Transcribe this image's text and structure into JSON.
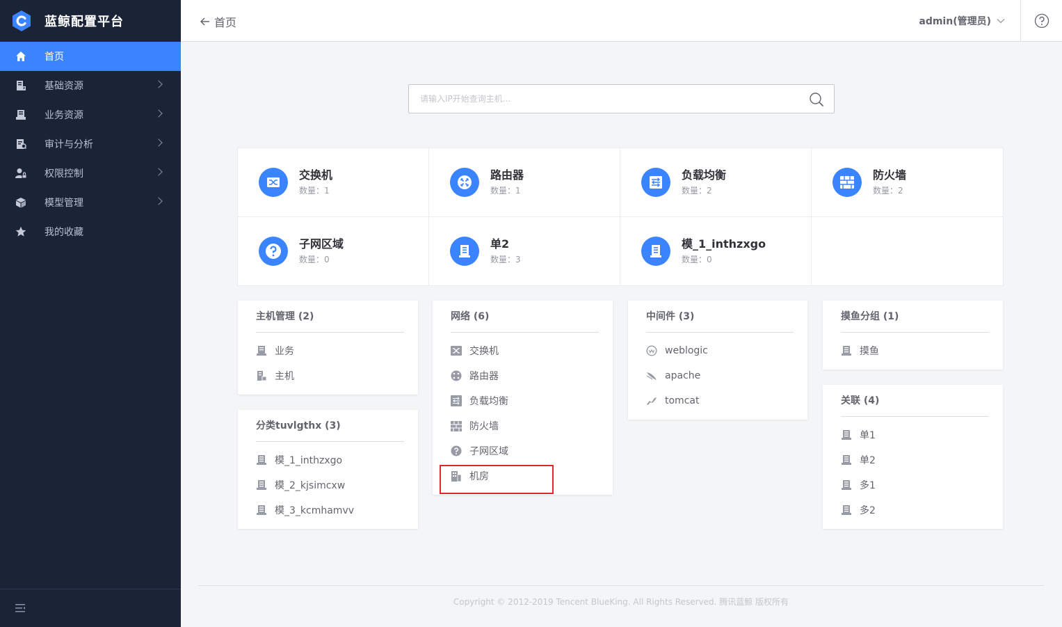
{
  "brand": {
    "title": "蓝鲸配置平台"
  },
  "sidebar": {
    "items": [
      {
        "label": "首页",
        "icon": "home-icon",
        "active": true,
        "arrow": false
      },
      {
        "label": "基础资源",
        "icon": "basic-resource-icon",
        "arrow": true
      },
      {
        "label": "业务资源",
        "icon": "business-resource-icon",
        "arrow": true
      },
      {
        "label": "审计与分析",
        "icon": "audit-icon",
        "arrow": true
      },
      {
        "label": "权限控制",
        "icon": "permission-icon",
        "arrow": true
      },
      {
        "label": "模型管理",
        "icon": "model-cube-icon",
        "arrow": true
      },
      {
        "label": "我的收藏",
        "icon": "star-icon",
        "arrow": false
      }
    ]
  },
  "header": {
    "back_label": "首页",
    "user_label": "admin(管理员)"
  },
  "search": {
    "placeholder": "请输入IP开始查询主机..."
  },
  "resources": {
    "count_prefix": "数量：",
    "items": [
      {
        "name": "交换机",
        "count": "1",
        "icon": "switch-icon"
      },
      {
        "name": "路由器",
        "count": "1",
        "icon": "router-icon"
      },
      {
        "name": "负载均衡",
        "count": "2",
        "icon": "load-balance-icon"
      },
      {
        "name": "防火墙",
        "count": "2",
        "icon": "firewall-icon"
      },
      {
        "name": "子网区域",
        "count": "0",
        "icon": "question-icon"
      },
      {
        "name": "单2",
        "count": "3",
        "icon": "model-icon"
      },
      {
        "name": "模_1_inthzxgo",
        "count": "0",
        "icon": "model-icon"
      }
    ]
  },
  "cards": {
    "host_mgmt": {
      "title": "主机管理 (2)",
      "items": [
        "业务",
        "主机"
      ]
    },
    "category": {
      "title": "分类tuvlgthx (3)",
      "items": [
        "模_1_inthzxgo",
        "模_2_kjsimcxw",
        "模_3_kcmhamvv"
      ]
    },
    "network": {
      "title": "网络 (6)",
      "items": [
        "交换机",
        "路由器",
        "负载均衡",
        "防火墙",
        "子网区域",
        "机房"
      ]
    },
    "middleware": {
      "title": "中间件 (3)",
      "items": [
        "weblogic",
        "apache",
        "tomcat"
      ]
    },
    "moyu": {
      "title": "摸鱼分组 (1)",
      "items": [
        "摸鱼"
      ]
    },
    "relation": {
      "title": "关联 (4)",
      "items": [
        "单1",
        "单2",
        "多1",
        "多2"
      ]
    }
  },
  "footer": {
    "copyright": "Copyright © 2012-2019 Tencent BlueKing. All Rights Reserved. 腾讯蓝鲸 版权所有"
  },
  "colors": {
    "sidebar_bg": "#1b2337",
    "accent": "#3a84ff",
    "highlight": "#e0262f"
  }
}
